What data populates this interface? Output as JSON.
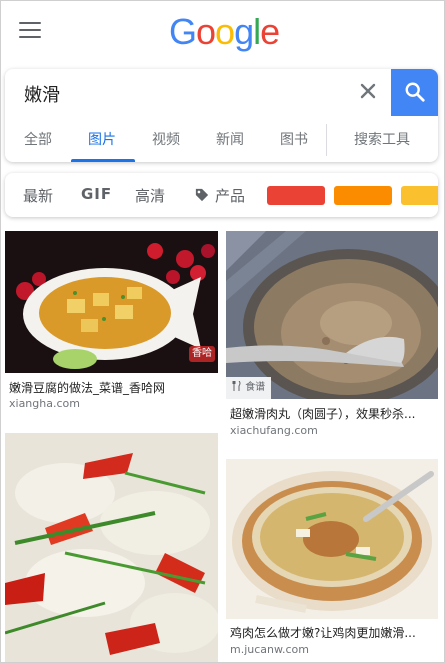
{
  "header": {
    "logo_letters": [
      {
        "ch": "G",
        "color": "#4285f4"
      },
      {
        "ch": "o",
        "color": "#ea4335"
      },
      {
        "ch": "o",
        "color": "#fbbc05"
      },
      {
        "ch": "g",
        "color": "#4285f4"
      },
      {
        "ch": "l",
        "color": "#34a853"
      },
      {
        "ch": "e",
        "color": "#ea4335"
      }
    ]
  },
  "search": {
    "query": "嫩滑",
    "accent": "#4285f4"
  },
  "tabs": [
    {
      "label": "全部"
    },
    {
      "label": "图片"
    },
    {
      "label": "视频"
    },
    {
      "label": "新闻"
    },
    {
      "label": "图书"
    },
    {
      "label": "搜索工具"
    }
  ],
  "chips": {
    "latest": "最新",
    "gif": "GIF",
    "hd": "高清",
    "product": "产品",
    "colors": [
      "#ea4335",
      "#fb8c00",
      "#fbc02d"
    ]
  },
  "results": [
    {
      "title": "嫩滑豆腐的做法_菜谱_香哈网",
      "domain": "xiangha.com",
      "badge": "香哈"
    },
    {
      "title": "超嫩滑肉丸（肉圆子），效果秒杀...",
      "domain": "xiachufang.com",
      "badge": "食谱"
    },
    {
      "title": "",
      "domain": "",
      "badge": ""
    },
    {
      "title": "鸡肉怎么做才嫩?让鸡肉更加嫩滑...",
      "domain": "m.jucanw.com",
      "badge": ""
    }
  ]
}
